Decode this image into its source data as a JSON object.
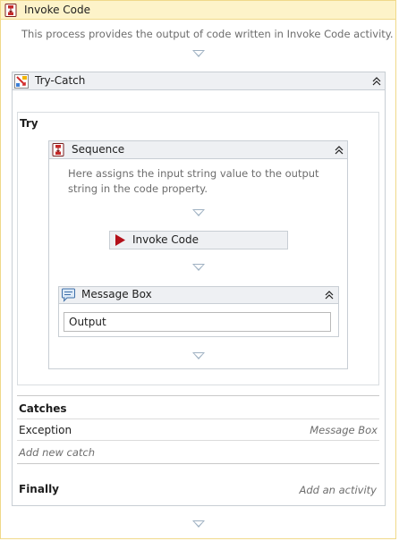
{
  "outer": {
    "title": "Invoke Code",
    "icon": "sequence-activity-icon",
    "description": "This process provides the output of code written in Invoke Code activity."
  },
  "try_catch": {
    "title": "Try-Catch",
    "icon": "try-catch-icon",
    "try_label": "Try",
    "sequence": {
      "title": "Sequence",
      "icon": "sequence-activity-icon",
      "description": "Here assigns the input string value to the output string in the code property.",
      "invoke_code": {
        "title": "Invoke Code",
        "icon": "invoke-code-play-icon"
      },
      "message_box": {
        "title": "Message Box",
        "icon": "message-box-icon",
        "text": "Output"
      }
    },
    "catches_label": "Catches",
    "catches": [
      {
        "exception": "Exception",
        "handler": "Message Box"
      }
    ],
    "add_catch_label": "Add new catch",
    "finally_label": "Finally",
    "finally_placeholder": "Add an activity"
  },
  "colors": {
    "outer_border": "#f0d98a",
    "outer_header": "#fdf3c9",
    "container_border": "#c8ced4",
    "header_gray": "#eef0f3",
    "arrow": "#9fb1c2",
    "invoke_red": "#b3101a"
  }
}
